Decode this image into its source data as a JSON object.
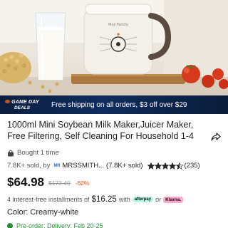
{
  "promo": {
    "badge_line1": "GAME DAY",
    "badge_line2": "DEALS",
    "text": "Free shipping on all orders, $3 off over $29"
  },
  "product": {
    "title": "1000ml Mini Soybean Milk Maker,Juicer Maker, Free Filtering, Self Cleaning  For Household  1-4",
    "bought": "Bought 1 time",
    "sold": "7.8K+ sold, by",
    "shop_logo": "MR",
    "shop_name": "MRSSMITH...",
    "shop_sold": "(7.8K+ sold)",
    "rating": 4.5,
    "rating_count": "(235)",
    "price": "$64.98",
    "was_price": "$172.49",
    "discount": "-62%",
    "install_prefix": "4 interest-free installments of",
    "install_amount": "$16.25",
    "install_with": "with",
    "afterpay_label": "afterpay",
    "install_or": "or",
    "klarna_label": "Klarna.",
    "color_label": "Color: Creamy-white",
    "preorder": "Pre-order: Delivery: Feb 20-25"
  },
  "appliance_label": "Moji Family",
  "colors": {
    "promo_bg": "#0f2d5e",
    "discount": "#e0521a",
    "star": "#222222",
    "afterpay": "#b2fce4",
    "klarna": "#ffa8cd"
  },
  "icons": {
    "share": "share-icon",
    "bag": "shopping-bag-icon",
    "star": "star-icon"
  }
}
